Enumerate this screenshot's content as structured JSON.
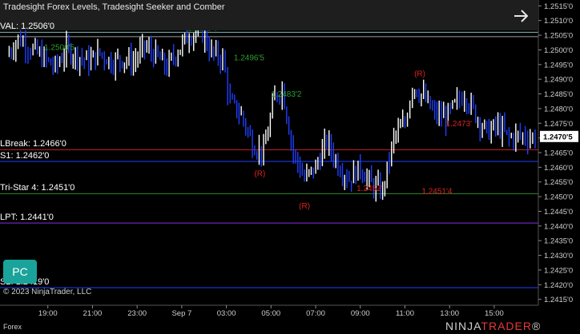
{
  "window": {
    "title": "Tradesight Forex Levels, Tradesight Seeker and Comber",
    "instrument_tab": "Forex",
    "copyright": "© 2023 NinjaTrader, LLC",
    "logo": {
      "main": "NINJA",
      "brand": "TRADER",
      "suffix": "®"
    },
    "pc_button": "PC",
    "arrow_icon": "arrow-right-icon"
  },
  "colors": {
    "background": "#000000",
    "header": "#1e1e1e",
    "up_bar": "#ffffff",
    "down_bar": "#1f3fff",
    "marker_green": "#2e9d2e",
    "marker_red": "#e02020",
    "current_price_bg": "#ffffff",
    "pc_button": "#1aa39a"
  },
  "levels": [
    {
      "label": "VAL: 1.2506'0",
      "price": 1.2506,
      "color": "#7fbfbf",
      "show_label": true
    },
    {
      "label": "",
      "price": 1.25045,
      "color": "#a0a0a0",
      "show_label": false
    },
    {
      "label": "LBreak: 1.2466'0",
      "price": 1.2466,
      "color": "#d02020",
      "show_label": true
    },
    {
      "label": "S1: 1.2462'0",
      "price": 1.2462,
      "color": "#2040ff",
      "show_label": true
    },
    {
      "label": "Tri-Star 4: 1.2451'0",
      "price": 1.2451,
      "color": "#2e8b2e",
      "show_label": true
    },
    {
      "label": "LPT: 1.2441'0",
      "price": 1.2441,
      "color": "#8a2be2",
      "show_label": true
    },
    {
      "label": "S2: 1.2419'0",
      "price": 1.2419,
      "color": "#2040ff",
      "show_label": true
    }
  ],
  "annotations": [
    {
      "text": "1.2500'5",
      "price": 1.25,
      "time": "18:50",
      "color": "#2e9d2e"
    },
    {
      "text": "1.2505'0",
      "price": 1.25065,
      "time": "01:15",
      "color": "#2e9d2e"
    },
    {
      "text": "1.2496'5",
      "price": 1.24965,
      "time": "03:20",
      "color": "#2e9d2e"
    },
    {
      "text": "1.2483'2",
      "price": 1.2484,
      "time": "05:00",
      "color": "#2e9d2e"
    },
    {
      "text": "1.2473'",
      "price": 1.2474,
      "time": "12:50",
      "color": "#e02020"
    },
    {
      "text": "1.2452'",
      "price": 1.2452,
      "time": "08:50",
      "color": "#e02020"
    },
    {
      "text": "1.2451'4",
      "price": 1.2451,
      "time": "11:45",
      "color": "#e02020"
    },
    {
      "text": "(R)",
      "price": 1.2457,
      "time": "04:15",
      "color": "#e02020"
    },
    {
      "text": "(R)",
      "price": 1.2446,
      "time": "06:15",
      "color": "#e02020"
    },
    {
      "text": "(R)",
      "price": 1.2491,
      "time": "11:25",
      "color": "#e02020"
    }
  ],
  "chart_data": {
    "type": "candlestick",
    "instrument": "Forex",
    "yaxis": {
      "ticks": [
        "1.2515'0",
        "1.2510'0",
        "1.2505'0",
        "1.2500'0",
        "1.2495'0",
        "1.2490'0",
        "1.2485'0",
        "1.2480'0",
        "1.2475'0",
        "1.2470'0",
        "1.2465'0",
        "1.2460'0",
        "1.2455'0",
        "1.2450'0",
        "1.2445'0",
        "1.2440'0",
        "1.2435'0",
        "1.2430'0",
        "1.2425'0",
        "1.2420'0",
        "1.2415'0"
      ],
      "ylim": [
        1.2413,
        1.2517
      ]
    },
    "current_price": "1.2470'5",
    "xaxis": {
      "ticks": [
        "19:00",
        "21:00",
        "23:00",
        "Sep 7",
        "03:00",
        "05:00",
        "07:00",
        "09:00",
        "11:00",
        "13:00",
        "15:00"
      ],
      "range": [
        "17:00",
        "16:50"
      ]
    },
    "price_path": [
      [
        "17:10",
        1.2498
      ],
      [
        "17:40",
        1.2504
      ],
      [
        "18:20",
        1.25
      ],
      [
        "18:50",
        1.2497
      ],
      [
        "19:20",
        1.2494
      ],
      [
        "19:50",
        1.25
      ],
      [
        "20:20",
        1.2498
      ],
      [
        "20:50",
        1.2496
      ],
      [
        "21:20",
        1.2499
      ],
      [
        "21:50",
        1.2496
      ],
      [
        "22:20",
        1.2497
      ],
      [
        "22:50",
        1.2496
      ],
      [
        "23:20",
        1.2501
      ],
      [
        "23:50",
        1.2498
      ],
      [
        "00:20",
        1.2494
      ],
      [
        "00:50",
        1.25
      ],
      [
        "01:20",
        1.2505
      ],
      [
        "01:50",
        1.2507
      ],
      [
        "02:20",
        1.2499
      ],
      [
        "02:50",
        1.2497
      ],
      [
        "03:10",
        1.2482
      ],
      [
        "03:40",
        1.2478
      ],
      [
        "04:10",
        1.2468
      ],
      [
        "04:40",
        1.2465
      ],
      [
        "05:10",
        1.2484
      ],
      [
        "05:30",
        1.2487
      ],
      [
        "06:00",
        1.2465
      ],
      [
        "06:30",
        1.2456
      ],
      [
        "07:00",
        1.246
      ],
      [
        "07:30",
        1.2469
      ],
      [
        "08:00",
        1.2461
      ],
      [
        "08:30",
        1.2456
      ],
      [
        "09:00",
        1.246
      ],
      [
        "09:30",
        1.2454
      ],
      [
        "10:00",
        1.2452
      ],
      [
        "10:30",
        1.247
      ],
      [
        "11:00",
        1.2475
      ],
      [
        "11:20",
        1.2488
      ],
      [
        "11:50",
        1.2484
      ],
      [
        "12:20",
        1.2478
      ],
      [
        "12:50",
        1.2477
      ],
      [
        "13:20",
        1.2482
      ],
      [
        "13:40",
        1.2485
      ],
      [
        "14:10",
        1.2478
      ],
      [
        "14:40",
        1.2472
      ],
      [
        "15:10",
        1.2474
      ],
      [
        "15:40",
        1.247
      ],
      [
        "16:10",
        1.2471
      ],
      [
        "16:50",
        1.247
      ]
    ]
  }
}
